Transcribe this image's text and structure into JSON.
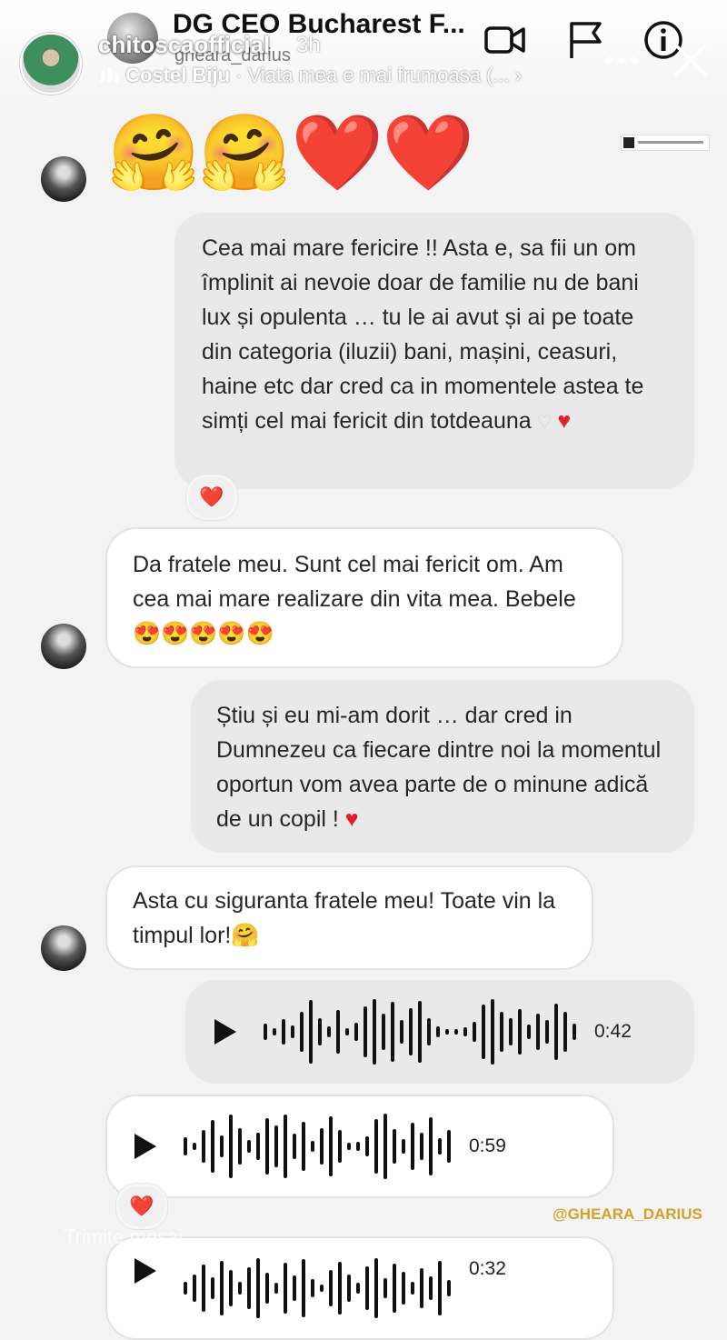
{
  "story": {
    "username": "chitoscaofficial",
    "time": "3h",
    "music_artist": "Costel Biju",
    "music_separator": "·",
    "music_title": "Viata mea e mai frumoasa (..."
  },
  "chat_header": {
    "name": "DG CEO Bucharest F...",
    "username": "gneara_darius"
  },
  "messages": {
    "emoji_row": [
      "🤗",
      "🤗",
      "❤️",
      "❤️"
    ],
    "m1": {
      "text": "Cea mai mare fericire !! Asta e, sa fii un om împlinit ai nevoie doar de familie nu de bani lux și opulenta … tu le ai avut și ai pe toate din categoria (iluzii) bani, mașini, ceasuri, haine  etc dar cred ca in momentele astea te simți cel mai fericit din totdeauna",
      "reaction": "❤️"
    },
    "m2": {
      "text": "Da fratele meu. Sunt cel mai fericit om. Am cea mai mare realizare din vita mea. Bebele😍😍😍😍😍"
    },
    "m3": {
      "text": "Știu și eu mi-am dorit … dar cred in Dumnezeu ca fiecare dintre noi la momentul oportun vom avea parte de o minune adică de un copil !"
    },
    "m4": {
      "text": "Asta cu siguranta fratele meu! Toate vin la timpul lor!🤗"
    },
    "voice1": {
      "duration": "0:42"
    },
    "voice2": {
      "duration": "0:59",
      "reaction": "❤️"
    },
    "voice3": {
      "duration": "0:32"
    }
  },
  "watermark": "@GHEARA_DARIUS",
  "reply_placeholder": "Trimite mesaj",
  "colors": {
    "heart": "#e0202a",
    "watermark": "#d3a12a",
    "incoming_bubble": "#ffffff",
    "outgoing_bubble": "#e9e9e9"
  }
}
